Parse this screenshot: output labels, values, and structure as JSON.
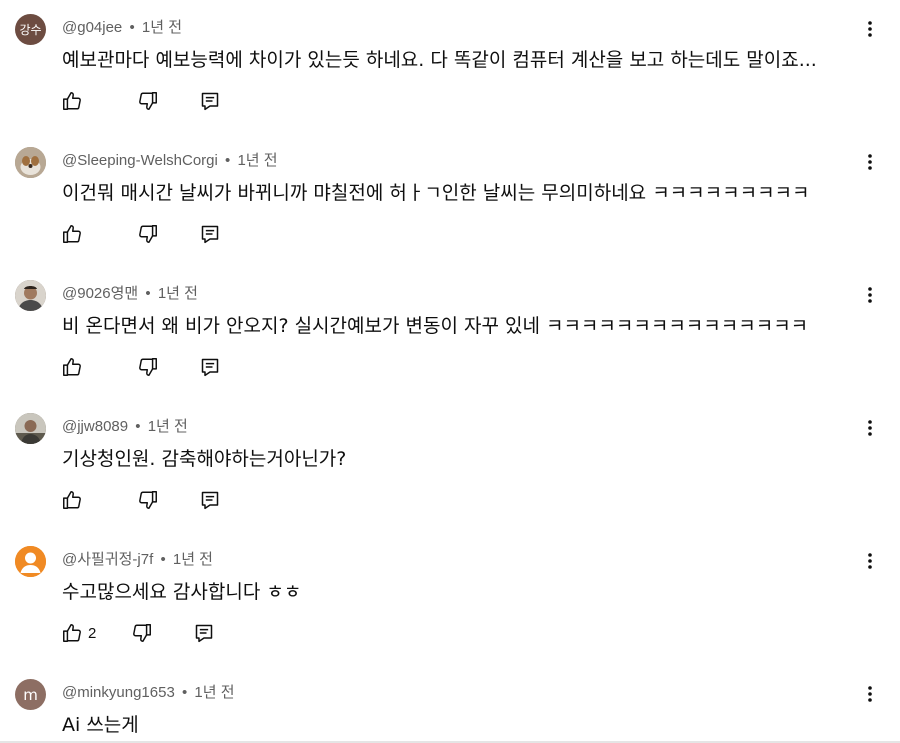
{
  "comments": [
    {
      "handle": "@g04jee",
      "time": "1년 전",
      "text": "예보관마다 예보능력에 차이가 있는듯 하네요. 다 똑같이 컴퓨터 계산을 보고 하는데도 말이죠...",
      "like_count": "",
      "avatar": {
        "type": "initials",
        "initials": "강수",
        "color": "#6d4c41"
      },
      "labels": {
        "like": "like-icon",
        "dislike": "dislike-icon",
        "reply": "reply-icon",
        "more": "more-vert-icon"
      }
    },
    {
      "handle": "@Sleeping-WelshCorgi",
      "time": "1년 전",
      "text": "이건뭐 매시간 날씨가 바뀌니까 먀칠전에 허ㅏㄱ인한 날씨는 무의미하네요 ㅋㅋㅋㅋㅋㅋㅋㅋㅋ",
      "like_count": "",
      "avatar": {
        "type": "photo",
        "color": "#9e8f7c"
      }
    },
    {
      "handle": "@9026영맨",
      "time": "1년 전",
      "text": "비 온다면서 왜 비가 안오지? 실시간예보가 변동이 자꾸 있네 ㅋㅋㅋㅋㅋㅋㅋㅋㅋㅋㅋㅋㅋㅋㅋ",
      "like_count": "",
      "avatar": {
        "type": "photo",
        "color": "#7a6a5e"
      }
    },
    {
      "handle": "@jjw8089",
      "time": "1년 전",
      "text": "기상청인원. 감축해야하는거아닌가?",
      "like_count": "",
      "avatar": {
        "type": "photo",
        "color": "#6f6b5a"
      }
    },
    {
      "handle": "@사필귀정-j7f",
      "time": "1년 전",
      "text": "수고많으세요 감사합니다 ㅎㅎ",
      "like_count": "2",
      "avatar": {
        "type": "person",
        "color": "#f08a24"
      }
    },
    {
      "handle": "@minkyung1653",
      "time": "1년 전",
      "text": "Ai 쓰는게",
      "like_count": "",
      "avatar": {
        "type": "initials",
        "initials": "m",
        "color": "#8d6e63"
      }
    }
  ],
  "separator": "•",
  "colors": {
    "meta_text": "#606060",
    "body_text": "#0f0f0f",
    "icon": "#0f0f0f"
  }
}
